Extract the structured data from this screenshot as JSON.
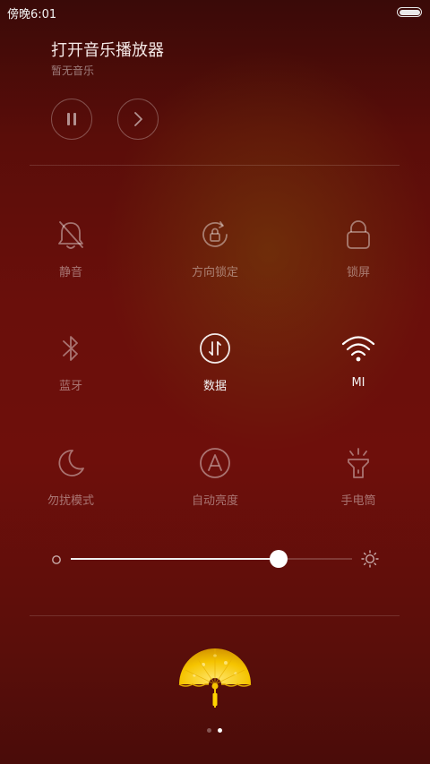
{
  "status_bar": {
    "time": "傍晚6:01",
    "battery_level": 1.0
  },
  "music": {
    "title": "打开音乐播放器",
    "subtitle": "暂无音乐",
    "pause_icon": "pause-icon",
    "next_icon": "next-icon"
  },
  "toggles": [
    {
      "label": "静音",
      "icon": "bell-muted-icon",
      "active": false
    },
    {
      "label": "方向锁定",
      "icon": "rotation-lock-icon",
      "active": false
    },
    {
      "label": "锁屏",
      "icon": "lock-icon",
      "active": false
    },
    {
      "label": "蓝牙",
      "icon": "bluetooth-icon",
      "active": false
    },
    {
      "label": "数据",
      "icon": "mobile-data-icon",
      "active": true
    },
    {
      "label": "MI",
      "icon": "wifi-icon",
      "active": true
    },
    {
      "label": "勿扰模式",
      "icon": "moon-icon",
      "active": false
    },
    {
      "label": "自动亮度",
      "icon": "auto-brightness-icon",
      "active": false
    },
    {
      "label": "手电筒",
      "icon": "flashlight-icon",
      "active": false
    }
  ],
  "brightness": {
    "level": 0.74,
    "low_icon": "brightness-low-icon",
    "high_icon": "brightness-high-icon"
  },
  "pager": {
    "pages": 2,
    "current": 2
  },
  "colors": {
    "active_text": "#f2f2f2",
    "inactive_text": "#9a6a66",
    "fan_gold": "#f5c400"
  }
}
